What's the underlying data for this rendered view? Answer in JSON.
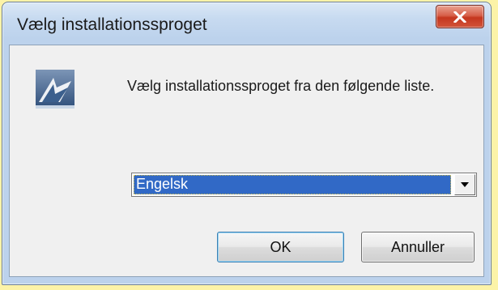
{
  "window": {
    "title": "Vælg installationssproget",
    "close_icon": "close-x-icon",
    "accent_color": "#c4371f"
  },
  "dialog": {
    "icon": "installer-app-icon",
    "message": "Vælg installationssproget fra den følgende liste.",
    "language_select": {
      "selected_value": "Engelsk",
      "arrow_icon": "dropdown-arrow-icon",
      "selection_color": "#3169c6"
    },
    "buttons": {
      "ok_label": "OK",
      "cancel_label": "Annuller"
    }
  }
}
